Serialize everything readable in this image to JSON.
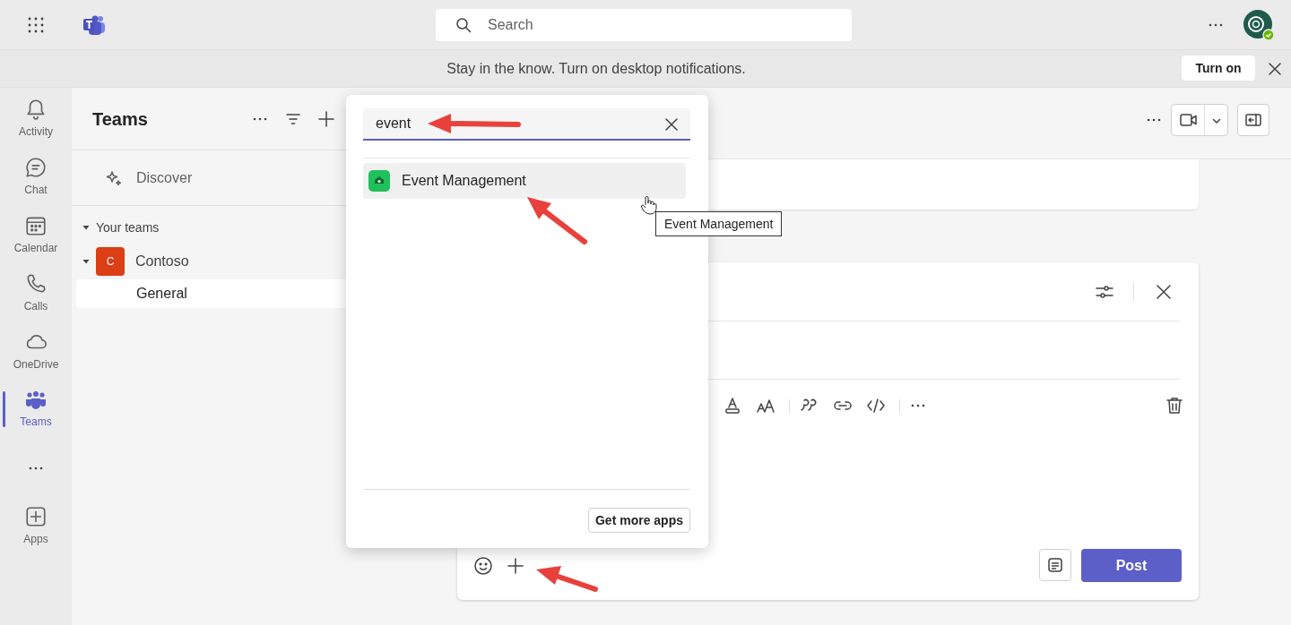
{
  "top_bar": {
    "search": {
      "placeholder": "Search"
    }
  },
  "notification": {
    "text": "Stay in the know. Turn on desktop notifications.",
    "button": "Turn on"
  },
  "rail": {
    "items": [
      {
        "label": "Activity",
        "selected": false
      },
      {
        "label": "Chat",
        "selected": false
      },
      {
        "label": "Calendar",
        "selected": false
      },
      {
        "label": "Calls",
        "selected": false
      },
      {
        "label": "OneDrive",
        "selected": false
      },
      {
        "label": "Teams",
        "selected": true
      }
    ],
    "apps": "Apps"
  },
  "teams_panel": {
    "title": "Teams",
    "discover": "Discover",
    "section": "Your teams",
    "teams": [
      {
        "initial": "C",
        "name": "Contoso",
        "expanded": true,
        "color": "#dc3e15",
        "channels": [
          {
            "name": "General",
            "selected": true
          }
        ]
      }
    ]
  },
  "app_picker": {
    "search_value": "event",
    "results": [
      {
        "name": "Event Management",
        "hovered": true
      }
    ],
    "tooltip": "Event Management",
    "button": "Get more apps"
  },
  "compose": {
    "post": "Post"
  }
}
